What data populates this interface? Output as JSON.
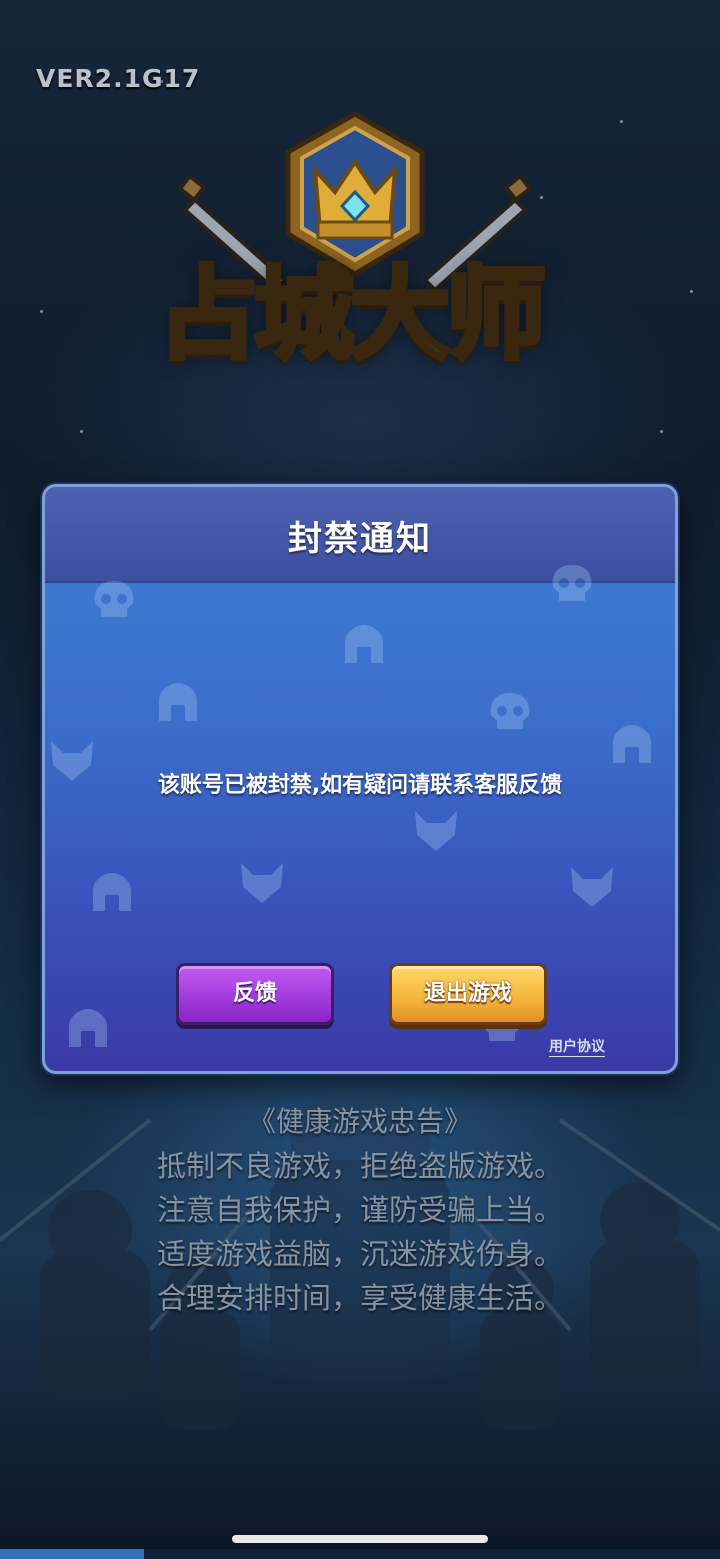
{
  "version": "VER2.1G17",
  "logo": {
    "title": "占城大师",
    "emblem_icon": "crown-shield-icon",
    "swords_icon": "crossed-swords-icon"
  },
  "dialog": {
    "title": "封禁通知",
    "message": "该账号已被封禁,如有疑问请联系客服反馈",
    "buttons": {
      "feedback": "反馈",
      "exit": "退出游戏"
    },
    "user_agreement": "用户协议",
    "decor_icons": [
      "skull-icon",
      "wolf-icon",
      "helmet-icon"
    ]
  },
  "health_advice": {
    "title": "《健康游戏忠告》",
    "lines": [
      "抵制不良游戏，拒绝盗版游戏。",
      "注意自我保护，谨防受骗上当。",
      "适度游戏益脑，沉迷游戏伤身。",
      "合理安排时间，享受健康生活。"
    ]
  },
  "loading_progress": 0.2,
  "colors": {
    "dialog_blue": "#3f7fd4",
    "feedback_purple": "#a63ee0",
    "exit_orange": "#f5b73c"
  }
}
